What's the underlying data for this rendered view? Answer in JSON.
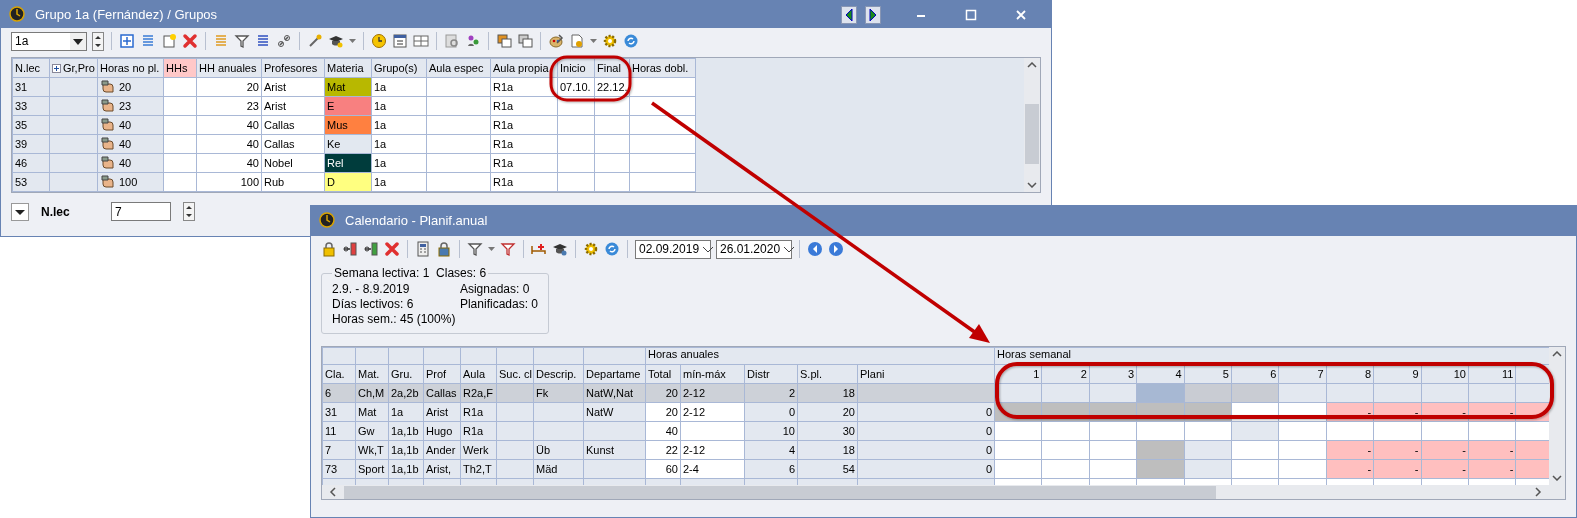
{
  "grupos_window": {
    "title": "Grupo 1a (Fernández) / Grupos",
    "class_select": {
      "value": "1a"
    },
    "table": {
      "columns": [
        {
          "label": "N.lec",
          "highlighted": false
        },
        {
          "label": "Gr,Pro",
          "highlighted": false
        },
        {
          "label": "Horas no pl.",
          "highlighted": false
        },
        {
          "label": "HHs",
          "highlighted": true
        },
        {
          "label": "HH anuales",
          "highlighted": false
        },
        {
          "label": "Profesores",
          "highlighted": false
        },
        {
          "label": "Materia",
          "highlighted": false
        },
        {
          "label": "Grupo(s)",
          "highlighted": false
        },
        {
          "label": "Aula espec",
          "highlighted": false
        },
        {
          "label": "Aula propia",
          "highlighted": false
        },
        {
          "label": "Inicio",
          "highlighted": false
        },
        {
          "label": "Final",
          "highlighted": false
        },
        {
          "label": "Horas dobl.",
          "highlighted": false
        }
      ],
      "rows": [
        {
          "n_lec": "31",
          "horas_no_pl": "20",
          "hh_anuales": "20",
          "profesores": "Arist",
          "materia": {
            "text": "Mat",
            "color": "#b8b800"
          },
          "grupos": "1a",
          "aula_propia": "R1a",
          "inicio": "07.10.",
          "final": "22.12."
        },
        {
          "n_lec": "33",
          "horas_no_pl": "23",
          "hh_anuales": "23",
          "profesores": "Arist",
          "materia": {
            "text": "E",
            "color": "#f88080"
          },
          "grupos": "1a",
          "aula_propia": "R1a"
        },
        {
          "n_lec": "35",
          "horas_no_pl": "40",
          "hh_anuales": "40",
          "profesores": "Callas",
          "materia": {
            "text": "Mus",
            "color": "#ff8040"
          },
          "grupos": "1a",
          "aula_propia": "R1a"
        },
        {
          "n_lec": "39",
          "horas_no_pl": "40",
          "hh_anuales": "40",
          "profesores": "Callas",
          "materia": {
            "text": "Ke",
            "color": "#e2e8f0"
          },
          "grupos": "1a",
          "aula_propia": "R1a"
        },
        {
          "n_lec": "46",
          "horas_no_pl": "40",
          "hh_anuales": "40",
          "profesores": "Nobel",
          "materia": {
            "text": "Rel",
            "color": "#003c3c"
          },
          "grupos": "1a",
          "aula_propia": "R1a"
        },
        {
          "n_lec": "53",
          "horas_no_pl": "100",
          "hh_anuales": "100",
          "profesores": "Rub",
          "materia": {
            "text": "D",
            "color": "#ffff80"
          },
          "grupos": "1a",
          "aula_propia": "R1a"
        }
      ]
    },
    "footer": {
      "label": "N.lec",
      "value": "7"
    }
  },
  "calendar_window": {
    "title": "Calendario - Planif.anual",
    "date_from": "02.09.2019",
    "date_to": "26.01.2020",
    "summary": {
      "legend": "Semana lectiva: 1  Clases: 6",
      "lines_left": [
        "2.9. - 8.9.2019",
        "Días lectivos: 6",
        "Horas sem.: 45 (100%)"
      ],
      "lines_right": [
        "Asignadas: 0",
        "Planificadas: 0"
      ]
    },
    "table": {
      "group_headers": [
        "Horas anuales",
        "Horas semanal"
      ],
      "columns": [
        "Cla.",
        "Mat.",
        "Gru.",
        "Prof",
        "Aula",
        "Suc. cl",
        "Descrip.",
        "Departame",
        "Total",
        "mín-máx",
        "Distr",
        "S.pl.",
        "Plani"
      ],
      "week_columns": [
        "1",
        "2",
        "3",
        "4",
        "5",
        "6",
        "7",
        "8",
        "9",
        "10",
        "11"
      ],
      "rows": [
        {
          "selected": true,
          "cla": "6",
          "mat": "Ch,M",
          "gru": "2a,2b",
          "prof": "Callas",
          "aula": "R2a,F",
          "descrip": "Fk",
          "departamento": "NatW,Nat",
          "total": "20",
          "min_max": "2-12",
          "distr": "2",
          "s_pl": "18",
          "weeks": [
            {
              "color": "#e3e8f0"
            },
            {
              "color": "#e3e8f0"
            },
            {
              "color": "#e3e8f0"
            },
            {
              "color": "#a7b8d3"
            },
            {
              "color": "#c9ccd3"
            },
            {
              "color": "#c9ccd3"
            },
            {
              "color": "#e3e8f0"
            },
            {
              "color": "#e3e8f0"
            },
            {
              "color": "#e3e8f0"
            },
            {
              "color": "#e3e8f0"
            },
            {
              "color": "#e3e8f0"
            }
          ]
        },
        {
          "selected": false,
          "cla": "31",
          "mat": "Mat",
          "gru": "1a",
          "prof": "Arist",
          "aula": "R1a",
          "departamento": "NatW",
          "total": "20",
          "min_max": "2-12",
          "distr": "0",
          "s_pl": "20",
          "plani": "0",
          "weeks": [
            {
              "color": "#bebebe"
            },
            {
              "color": "#bebebe"
            },
            {
              "color": "#bebebe"
            },
            {
              "color": "#bebebe"
            },
            {
              "color": "#bebebe"
            },
            {
              "color": "#ffffff"
            },
            {
              "color": "#ffffff"
            },
            {
              "color": "#ffbfbf",
              "text": "-"
            },
            {
              "color": "#ffbfbf",
              "text": "-"
            },
            {
              "color": "#ffbfbf",
              "text": "-"
            },
            {
              "color": "#ffbfbf",
              "text": "-"
            }
          ]
        },
        {
          "selected": false,
          "cla": "11",
          "mat": "Gw",
          "gru": "1a,1b",
          "prof": "Hugo",
          "aula": "R1a",
          "total": "40",
          "distr": "10",
          "s_pl": "30",
          "plani": "0",
          "weeks": [
            {
              "color": "#ffffff"
            },
            {
              "color": "#ffffff"
            },
            {
              "color": "#ffffff"
            },
            {
              "color": "#ffffff"
            },
            {
              "color": "#ffffff"
            },
            {
              "color": "#e3e8f0"
            },
            {
              "color": "#ffffff"
            },
            {
              "color": "#ffffff"
            },
            {
              "color": "#ffffff"
            },
            {
              "color": "#ffffff"
            },
            {
              "color": "#ffffff"
            }
          ]
        },
        {
          "selected": false,
          "cla": "7",
          "mat": "Wk,T",
          "gru": "1a,1b",
          "prof": "Ander",
          "aula": "Werk",
          "descrip": "Üb",
          "departamento": "Kunst",
          "total": "22",
          "min_max": "2-12",
          "distr": "4",
          "s_pl": "18",
          "plani": "0",
          "weeks": [
            {
              "color": "#ffffff"
            },
            {
              "color": "#ffffff"
            },
            {
              "color": "#ffffff"
            },
            {
              "color": "#bebebe"
            },
            {
              "color": "#e3e8f0"
            },
            {
              "color": "#ffffff"
            },
            {
              "color": "#ffffff"
            },
            {
              "color": "#ffbfbf",
              "text": "-"
            },
            {
              "color": "#ffbfbf",
              "text": "-"
            },
            {
              "color": "#ffbfbf",
              "text": "-"
            },
            {
              "color": "#ffbfbf",
              "text": "-"
            }
          ]
        },
        {
          "selected": false,
          "cla": "73",
          "mat": "Sport",
          "gru": "1a,1b",
          "prof": "Arist,",
          "aula": "Th2,T",
          "descrip": "Mäd",
          "total": "60",
          "min_max": "2-4",
          "distr": "6",
          "s_pl": "54",
          "plani": "0",
          "weeks": [
            {
              "color": "#ffffff"
            },
            {
              "color": "#ffffff"
            },
            {
              "color": "#ffffff"
            },
            {
              "color": "#bebebe"
            },
            {
              "color": "#e3e8f0"
            },
            {
              "color": "#ffffff"
            },
            {
              "color": "#ffffff"
            },
            {
              "color": "#ffbfbf",
              "text": "-"
            },
            {
              "color": "#ffbfbf",
              "text": "-"
            },
            {
              "color": "#ffbfbf",
              "text": "-"
            },
            {
              "color": "#ffbfbf",
              "text": "-"
            }
          ]
        }
      ]
    }
  }
}
